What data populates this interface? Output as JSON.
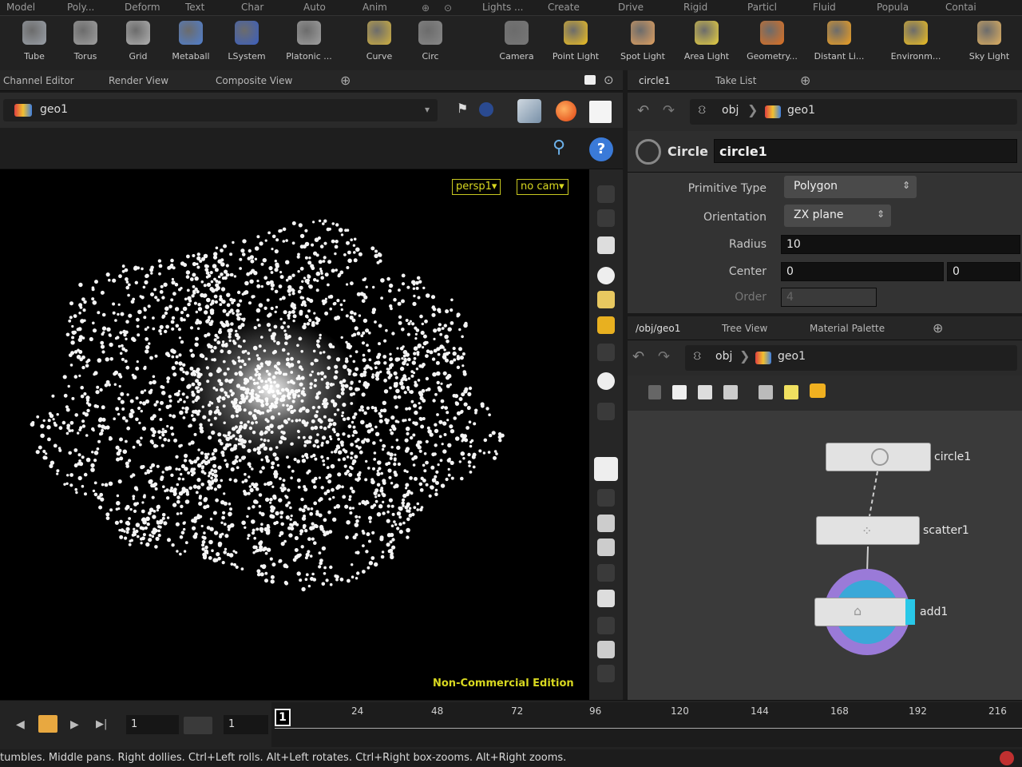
{
  "shelf_tabs": [
    "Model",
    "Poly...",
    "Deform",
    "Text",
    "Char",
    "Auto",
    "Anim",
    "Lights ...",
    "Create",
    "Drive",
    "Rigid",
    "Particl",
    "Fluid",
    "Popula",
    "Contai"
  ],
  "shelf_tools": [
    {
      "label": "Tube",
      "icon": "tube-icon",
      "color": "#9aa0a8"
    },
    {
      "label": "Torus",
      "icon": "torus-icon",
      "color": "#a0a0a0"
    },
    {
      "label": "Grid",
      "icon": "grid-icon",
      "color": "#b0b0b0"
    },
    {
      "label": "Metaball",
      "icon": "metaball-icon",
      "color": "#4f7fd0"
    },
    {
      "label": "LSystem",
      "icon": "lsystem-icon",
      "color": "#3a5fc0"
    },
    {
      "label": "Platonic ...",
      "icon": "platonic-icon",
      "color": "#a0a0a0"
    },
    {
      "label": "Curve",
      "icon": "curve-icon",
      "color": "#d0b040"
    },
    {
      "label": "Circ",
      "icon": "circle-icon",
      "color": "#888888"
    },
    {
      "label": "Camera",
      "icon": "camera-icon",
      "color": "#777777"
    },
    {
      "label": "Point Light",
      "icon": "point-light-icon",
      "color": "#f0c020"
    },
    {
      "label": "Spot Light",
      "icon": "spot-light-icon",
      "color": "#e0a060"
    },
    {
      "label": "Area Light",
      "icon": "area-light-icon",
      "color": "#e8d040"
    },
    {
      "label": "Geometry...",
      "icon": "geometry-light-icon",
      "color": "#e07020"
    },
    {
      "label": "Distant Li...",
      "icon": "distant-light-icon",
      "color": "#f0a020"
    },
    {
      "label": "Environm...",
      "icon": "environment-light-icon",
      "color": "#f0c020"
    },
    {
      "label": "Sky Light",
      "icon": "sky-light-icon",
      "color": "#e0b060"
    }
  ],
  "left_tabs": [
    "Channel Editor",
    "Render View",
    "Composite View"
  ],
  "left_path": "geo1",
  "viewport": {
    "camera_menu": "persp1",
    "cam_menu": "no cam",
    "watermark": "Non-Commercial Edition"
  },
  "right_tabs": [
    "circle1",
    "Take List"
  ],
  "right_path": {
    "root": "obj",
    "node": "geo1"
  },
  "node_header": {
    "type": "Circle",
    "name": "circle1"
  },
  "params": {
    "primitive_type": {
      "label": "Primitive Type",
      "value": "Polygon"
    },
    "orientation": {
      "label": "Orientation",
      "value": "ZX plane"
    },
    "radius": {
      "label": "Radius",
      "value": "10"
    },
    "center": {
      "label": "Center",
      "x": "0",
      "y": "0"
    },
    "order": {
      "label": "Order",
      "value": "4"
    }
  },
  "network_tabs": [
    "/obj/geo1",
    "Tree View",
    "Material Palette"
  ],
  "network_path": {
    "root": "obj",
    "node": "geo1"
  },
  "nodes": [
    {
      "name": "circle1"
    },
    {
      "name": "scatter1"
    },
    {
      "name": "add1"
    }
  ],
  "playbar": {
    "frame": "1",
    "end_frame": "1",
    "current_marker": "1",
    "ticks": [
      "24",
      "48",
      "72",
      "96",
      "120",
      "144",
      "168",
      "192",
      "216"
    ]
  },
  "status": "tumbles. Middle pans. Right dollies. Ctrl+Left rolls. Alt+Left rotates. Ctrl+Right box-zooms. Alt+Right zooms.",
  "colors": {
    "accent_yellow": "#d8d820",
    "display_flag": "#28c8e8",
    "node_ring": "#9a7ad8"
  }
}
